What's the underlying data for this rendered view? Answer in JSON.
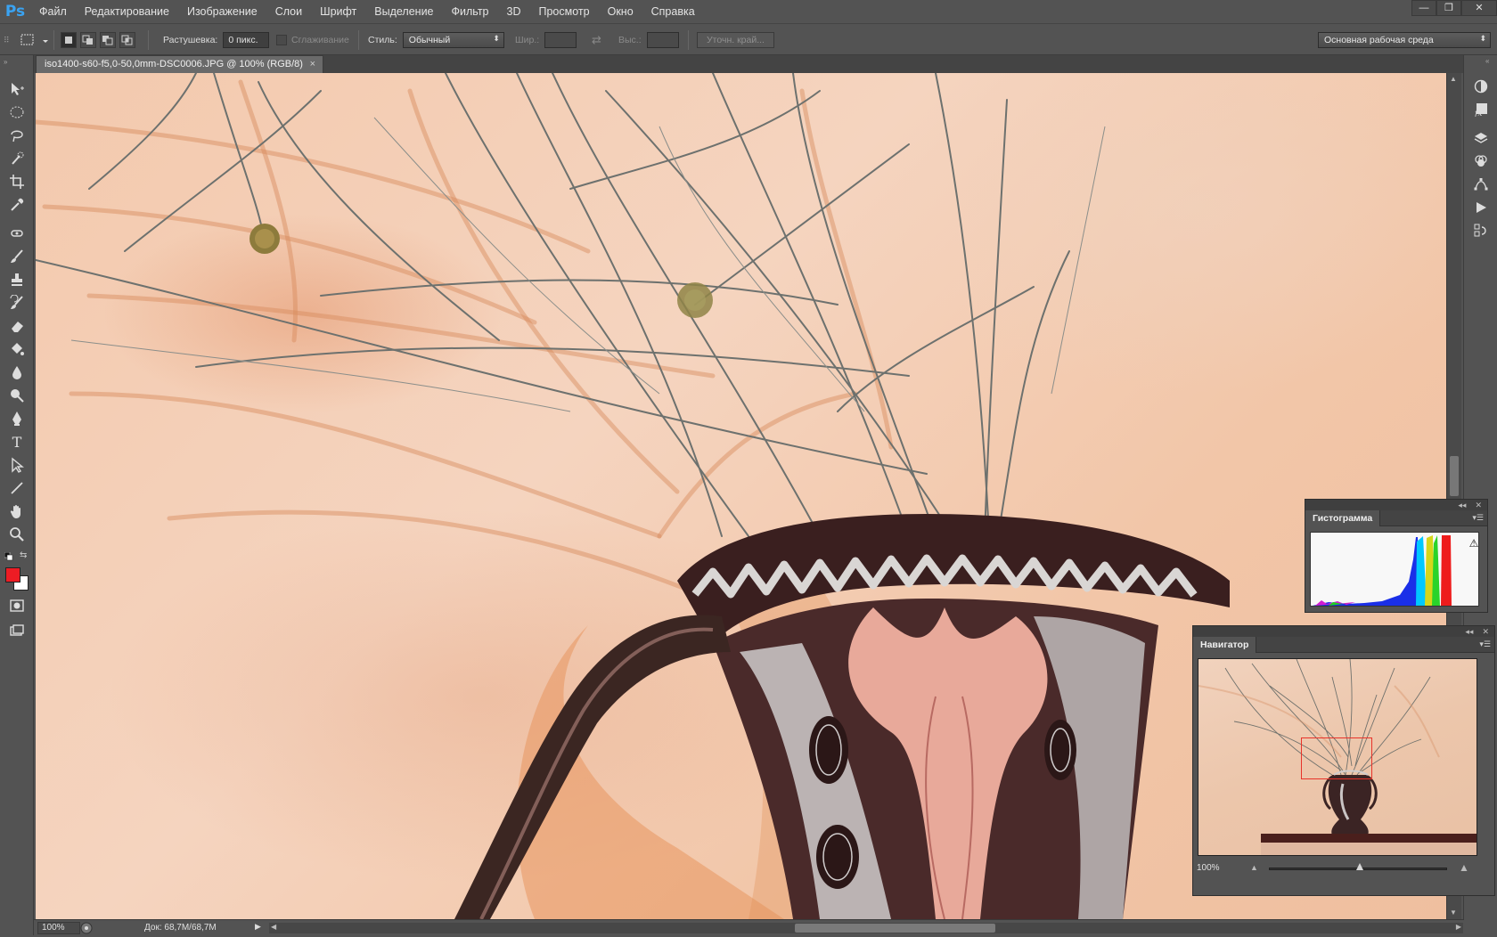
{
  "app": {
    "logo": "Ps"
  },
  "menu": [
    "Файл",
    "Редактирование",
    "Изображение",
    "Слои",
    "Шрифт",
    "Выделение",
    "Фильтр",
    "3D",
    "Просмотр",
    "Окно",
    "Справка"
  ],
  "window_controls": {
    "minimize": "—",
    "restore": "❐",
    "close": "✕"
  },
  "options": {
    "feather_label": "Растушевка:",
    "feather_value": "0 пикс.",
    "antialias_label": "Сглаживание",
    "style_label": "Стиль:",
    "style_value": "Обычный",
    "width_label": "Шир.:",
    "height_label": "Выс.:",
    "refine_edge": "Уточн. край...",
    "workspace": "Основная рабочая среда"
  },
  "document": {
    "tab_title": "iso1400-s60-f5,0-50,0mm-DSC0006.JPG @ 100% (RGB/8)",
    "close": "×"
  },
  "status": {
    "zoom": "100%",
    "doc_info": "Док: 68,7M/68,7M"
  },
  "histogram_panel": {
    "title": "Гистограмма",
    "warning": "⚠"
  },
  "navigator_panel": {
    "title": "Навигатор",
    "zoom": "100%"
  },
  "colors": {
    "foreground": "#ed1c24",
    "background": "#ffffff",
    "nav_view_rect": "#e8332a"
  },
  "tools": [
    "move-icon",
    "marquee-ellipse-icon",
    "lasso-icon",
    "quick-select-icon",
    "crop-icon",
    "eyedropper-icon",
    "spot-healing-icon",
    "brush-icon",
    "clone-stamp-icon",
    "history-brush-icon",
    "eraser-icon",
    "paint-bucket-icon",
    "blur-icon",
    "dodge-icon",
    "pen-icon",
    "type-icon",
    "path-select-icon",
    "line-icon",
    "hand-icon",
    "zoom-icon"
  ]
}
